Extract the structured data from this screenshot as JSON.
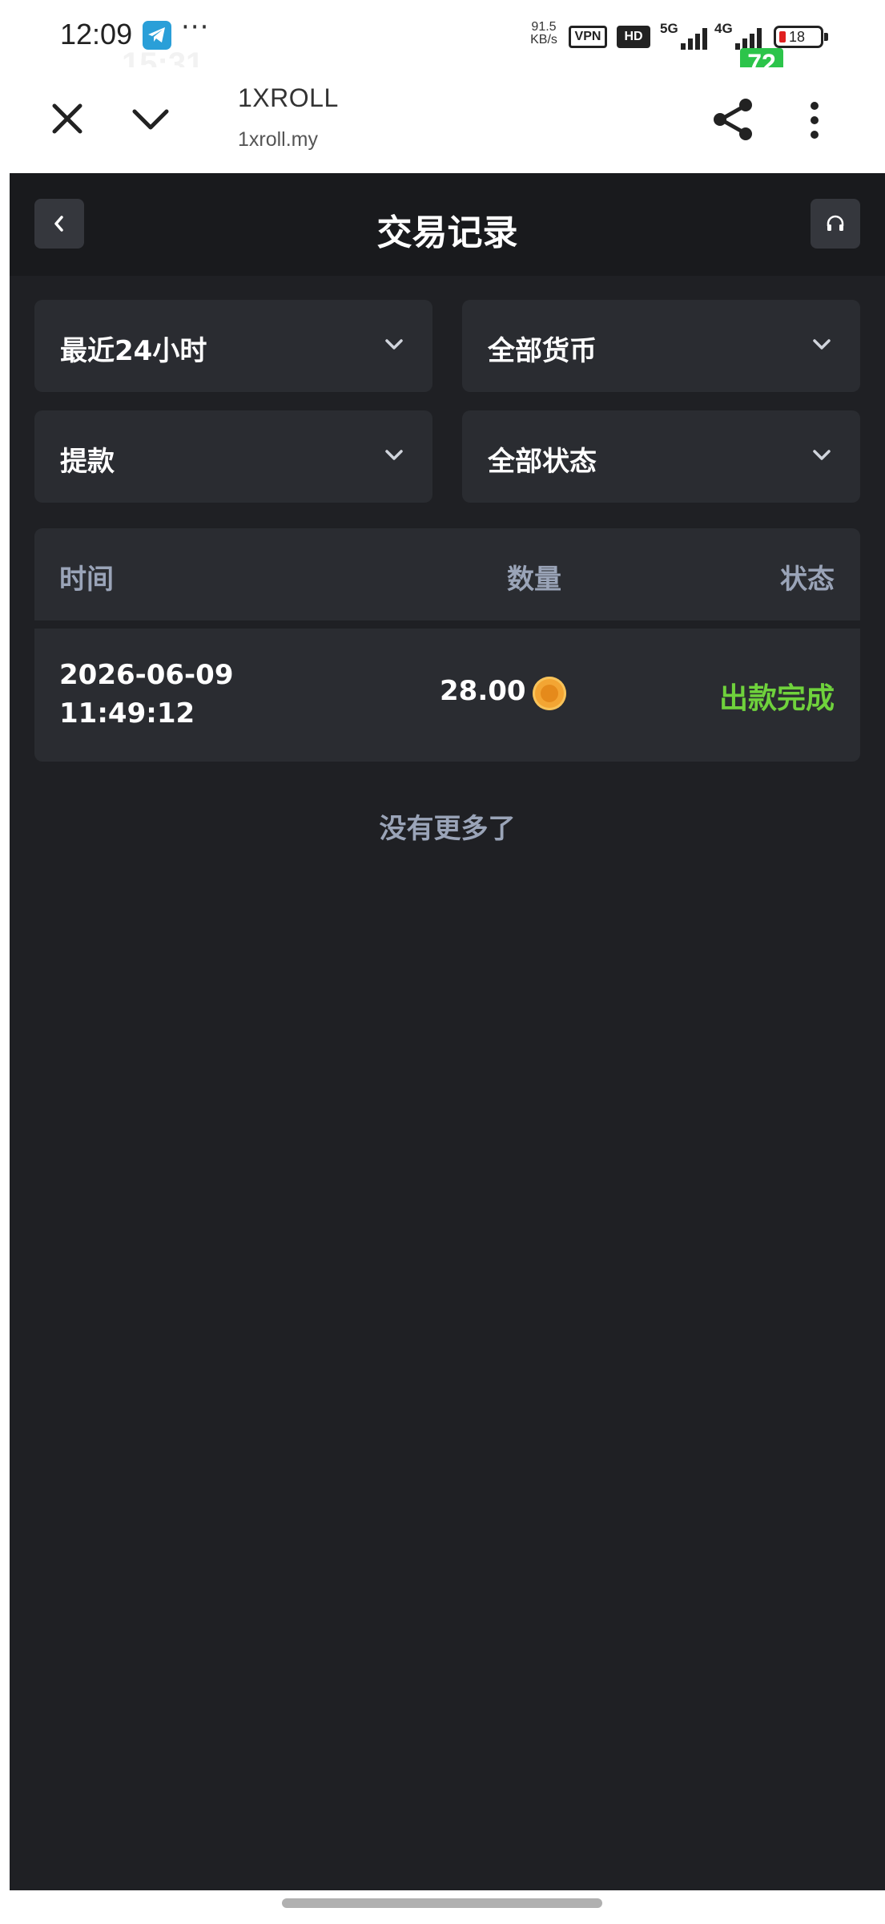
{
  "status_bar": {
    "time": "12:09",
    "more": "···",
    "net_speed_value": "91.5",
    "net_speed_unit": "KB/s",
    "vpn": "VPN",
    "hd": "HD",
    "sim1_label": "5G",
    "sim2_label": "4G",
    "battery": "18",
    "overlay_time": "15:31",
    "overlay_badge": "72"
  },
  "browser": {
    "site_title": "1XROLL",
    "site_url": "1xroll.my"
  },
  "page": {
    "title": "交易记录"
  },
  "filters": {
    "time_range": "最近24小时",
    "currency": "全部货币",
    "type": "提款",
    "status": "全部状态"
  },
  "table": {
    "headers": {
      "time": "时间",
      "amount": "数量",
      "status": "状态"
    },
    "rows": [
      {
        "date": "2026-06-09",
        "time": "11:49:12",
        "amount": "28.00",
        "status": "出款完成"
      }
    ]
  },
  "footer_note": "没有更多了",
  "colors": {
    "background": "#1f2024",
    "card": "#2a2c31",
    "status_success": "#6fd23c",
    "header_text": "#9aa4b8"
  },
  "icons": [
    "telegram-icon",
    "close-icon",
    "chevron-down-icon",
    "share-icon",
    "more-vertical-icon",
    "back-icon",
    "headset-icon",
    "coin-icon"
  ]
}
